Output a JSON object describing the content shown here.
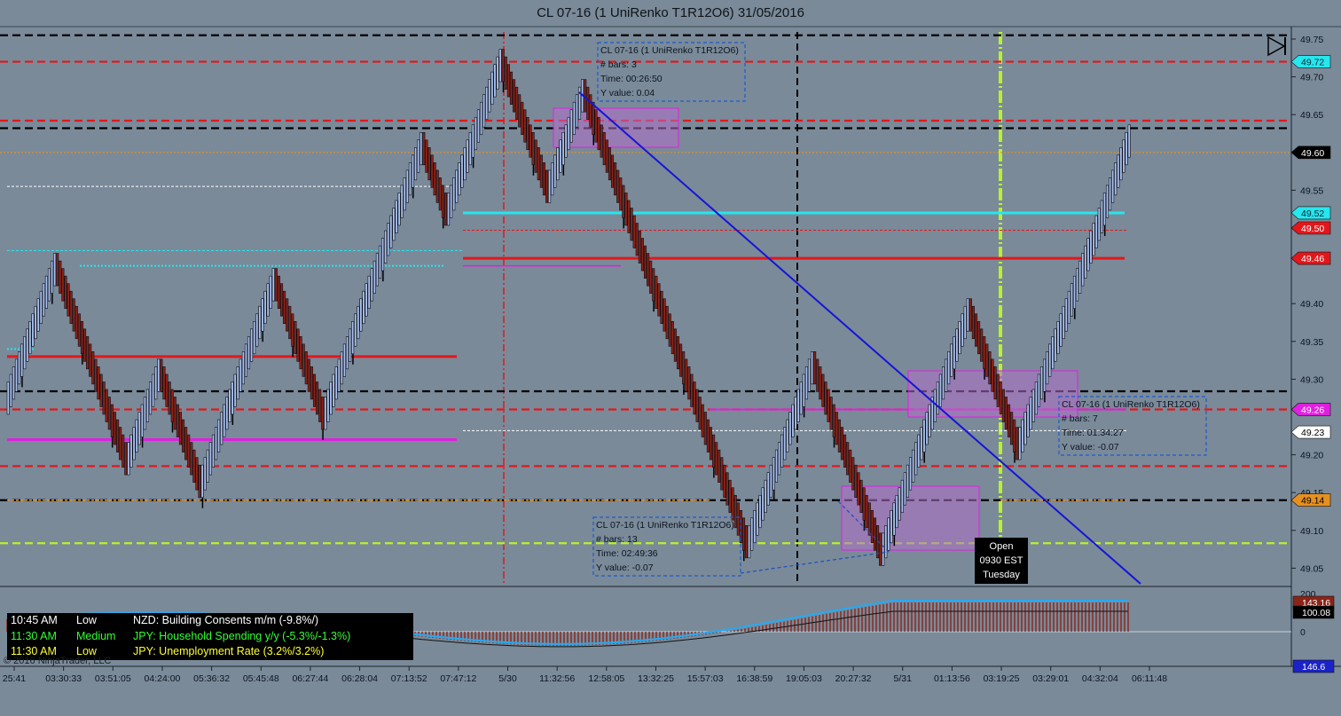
{
  "title": "CL 07-16 (1 UniRenko T1R12O6)  31/05/2016",
  "colors": {
    "background": "#7a8a99",
    "up_bar": "#a8c0ec",
    "down_bar": "#8b2418",
    "red_line": "#e3171b",
    "magenta_line": "#e020e0",
    "cyan_line": "#26e6ee",
    "lime_line": "#b8f22a",
    "blue_trend": "#1414d8",
    "orange_line": "#e69020",
    "magenta_zone": "#b070c8"
  },
  "chart_data": {
    "type": "bar",
    "price_axis": {
      "ticks": [
        49.75,
        49.7,
        49.65,
        49.55,
        49.4,
        49.35,
        49.3,
        49.2,
        49.15,
        49.1,
        49.05
      ],
      "range": [
        49.02,
        49.77
      ]
    },
    "time_axis_labels": [
      "25:41",
      "03:30:33",
      "03:51:05",
      "04:24:00",
      "05:36:32",
      "05:45:48",
      "06:27:44",
      "06:28:04",
      "07:13:52",
      "07:47:12",
      "5/30",
      "11:32:56",
      "12:58:05",
      "13:32:25",
      "15:57:03",
      "16:38:59",
      "19:05:03",
      "20:27:32",
      "5/31",
      "01:13:56",
      "03:19:25",
      "03:29:01",
      "04:32:04",
      "06:11:48"
    ],
    "price_markers": [
      {
        "value": "49.72",
        "price": 49.72,
        "bg": "#26e6ee",
        "fg": "#0a2a33"
      },
      {
        "value": "49.60",
        "price": 49.6,
        "bg": "#000000",
        "fg": "#ffffff"
      },
      {
        "value": "49.52",
        "price": 49.52,
        "bg": "#26e6ee",
        "fg": "#0a2a33"
      },
      {
        "value": "49.50",
        "price": 49.5,
        "bg": "#e3171b",
        "fg": "#ffffff"
      },
      {
        "value": "49.46",
        "price": 49.46,
        "bg": "#e3171b",
        "fg": "#ffffff"
      },
      {
        "value": "49.26",
        "price": 49.26,
        "bg": "#e020e0",
        "fg": "#ffffff"
      },
      {
        "value": "49.23",
        "price": 49.23,
        "bg": "#ffffff",
        "fg": "#000000"
      },
      {
        "value": "49.14",
        "price": 49.14,
        "bg": "#e69020",
        "fg": "#000000"
      }
    ],
    "swings": [
      {
        "from": 49.27,
        "to": 49.45
      },
      {
        "from": 49.45,
        "to": 49.19
      },
      {
        "from": 49.19,
        "to": 49.31
      },
      {
        "from": 49.31,
        "to": 49.16
      },
      {
        "from": 49.16,
        "to": 49.43
      },
      {
        "from": 49.43,
        "to": 49.25
      },
      {
        "from": 49.25,
        "to": 49.61
      },
      {
        "from": 49.61,
        "to": 49.52
      },
      {
        "from": 49.52,
        "to": 49.72
      },
      {
        "from": 49.72,
        "to": 49.55
      },
      {
        "from": 49.55,
        "to": 49.68
      },
      {
        "from": 49.68,
        "to": 49.08
      },
      {
        "from": 49.08,
        "to": 49.32
      },
      {
        "from": 49.32,
        "to": 49.07
      },
      {
        "from": 49.07,
        "to": 49.39
      },
      {
        "from": 49.39,
        "to": 49.21
      },
      {
        "from": 49.21,
        "to": 49.62
      }
    ],
    "levels": [
      {
        "price": 49.755,
        "color": "#000000",
        "style": "dash"
      },
      {
        "price": 49.72,
        "color": "#e3171b",
        "style": "dash"
      },
      {
        "price": 49.642,
        "color": "#e3171b",
        "style": "dash"
      },
      {
        "price": 49.632,
        "color": "#000000",
        "style": "dash"
      },
      {
        "price": 49.6,
        "color": "#e69020",
        "style": "dot"
      },
      {
        "price": 49.284,
        "color": "#000000",
        "style": "dash"
      },
      {
        "price": 49.26,
        "color": "#e3171b",
        "style": "dash"
      },
      {
        "price": 49.185,
        "color": "#e3171b",
        "style": "dash"
      },
      {
        "price": 49.14,
        "color": "#000000",
        "style": "dash"
      },
      {
        "price": 49.083,
        "color": "#b8f22a",
        "style": "dash"
      }
    ],
    "info_boxes": [
      {
        "title": "CL 07-16 (1 UniRenko T1R12O6)",
        "bars_label": "# bars:",
        "bars": "3",
        "time_label": "Time:",
        "time": "00:26:50",
        "y_label": "Y value:",
        "y": "0.04"
      },
      {
        "title": "CL 07-16 (1 UniRenko T1R12O6)",
        "bars_label": "# bars:",
        "bars": "13",
        "time_label": "Time:",
        "time": "02:49:36",
        "y_label": "Y value:",
        "y": "-0.07"
      },
      {
        "title": "CL 07-16 (1 UniRenko T1R12O6)",
        "bars_label": "# bars:",
        "bars": "7",
        "time_label": "Time:",
        "time": "01:34:27",
        "y_label": "Y value:",
        "y": "-0.07"
      }
    ],
    "oscillator": {
      "axis_labels": [
        "200",
        "0"
      ],
      "markers": [
        {
          "value": "143.16",
          "bg": "#8b2418",
          "fg": "#ffffff"
        },
        {
          "value": "100.08",
          "bg": "#000000",
          "fg": "#ffffff"
        },
        {
          "value": "146.6",
          "bg": "#1a22c8",
          "fg": "#ffffff"
        }
      ]
    }
  },
  "open_label": [
    "Open",
    "0930 EST",
    "Tuesday"
  ],
  "events": [
    {
      "time": "10:45 AM",
      "impact": "Low",
      "text": "NZD: Building Consents m/m (-9.8%/)",
      "color": "#ffffff"
    },
    {
      "time": "11:30 AM",
      "impact": "Medium",
      "text": "JPY: Household Spending y/y (-5.3%/-1.3%)",
      "color": "#33ff33"
    },
    {
      "time": "11:30 AM",
      "impact": "Low",
      "text": "JPY: Unemployment Rate (3.2%/3.2%)",
      "color": "#ffff33"
    }
  ],
  "copyright": "© 2016 NinjaTrader, LLC"
}
